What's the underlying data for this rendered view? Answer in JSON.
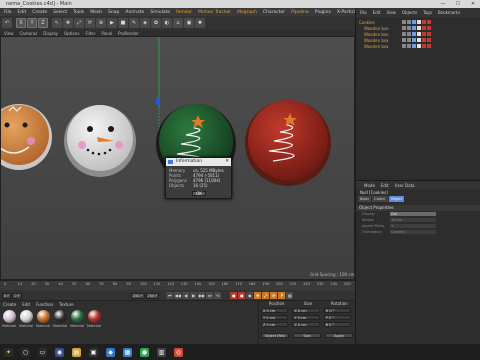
{
  "window": {
    "title": "nema_Cookies.c4d] - Main",
    "min": "—",
    "max": "☐",
    "close": "✕"
  },
  "menubar": [
    "File",
    "Edit",
    "Create",
    "Select",
    "Tools",
    "Mesh",
    "Snap",
    "Animate",
    "Simulate",
    "Render",
    "Motion Tracker",
    "Mograph",
    "Character",
    "Pipeline",
    "Plugins",
    "X-Particles",
    "RealFlow",
    "Octane",
    "Script",
    "Window",
    "Help"
  ],
  "menubar_highlight": [
    "Render",
    "Motion Tracker",
    "Mograph",
    "Pipeline",
    "Window",
    "Help"
  ],
  "toolbar": {
    "axis": [
      "X",
      "Y",
      "Z"
    ],
    "icons": [
      "undo-icon",
      "select-icon",
      "move-icon",
      "scale-icon",
      "rotate-icon",
      "coord-icon",
      "render-icon",
      "cube-icon",
      "pen-icon",
      "subdiv-icon",
      "flower-icon",
      "deform-icon",
      "scene-icon",
      "camera-icon",
      "light-icon"
    ]
  },
  "viewport": {
    "menu": [
      "View",
      "Cameras",
      "Display",
      "Options",
      "Filter",
      "Panel",
      "ProRender"
    ],
    "grid_label": "Grid Spacing : 100 cm"
  },
  "info_dialog": {
    "title": "Information",
    "close": "✕",
    "rows": [
      {
        "k": "Memory",
        "v": "ca. 525 MBytes"
      },
      {
        "k": "Points",
        "v": "4794 (-5011)"
      },
      {
        "k": "Polygons",
        "v": "4796 (11004)"
      },
      {
        "k": "Objects",
        "v": "16 (25)"
      }
    ],
    "ok": "OK"
  },
  "timeline": {
    "ticks": [
      "0",
      "10",
      "20",
      "30",
      "40",
      "50",
      "60",
      "70",
      "80",
      "90",
      "100",
      "110",
      "120",
      "130",
      "140",
      "150",
      "160",
      "170",
      "180",
      "190",
      "200",
      "210",
      "220",
      "230",
      "240",
      "250"
    ],
    "start": "0 F",
    "current": "0 F",
    "end": "250 F",
    "end2": "250 F",
    "buttons": [
      "⏮",
      "◀◀",
      "◀",
      "▶",
      "▶▶",
      "⏭",
      "⟲"
    ]
  },
  "materials": {
    "menu": [
      "Create",
      "Edit",
      "Function",
      "Texture"
    ],
    "items": [
      {
        "label": "Material",
        "color": "#d9c2d8"
      },
      {
        "label": "Material",
        "color": "#d6d6d6"
      },
      {
        "label": "Material",
        "color": "#c8702c"
      },
      {
        "label": "Material",
        "color": "#2e2e2e"
      },
      {
        "label": "Material",
        "color": "#2d6e3f"
      },
      {
        "label": "Material",
        "color": "#b0322c"
      }
    ]
  },
  "coords": {
    "headers": [
      "Position",
      "Size",
      "Rotation"
    ],
    "rows": [
      {
        "p": "X  0 cm",
        "s": "X  0 cm",
        "r": "H  0 °"
      },
      {
        "p": "Y  0 cm",
        "s": "Y  0 cm",
        "r": "P  0 °"
      },
      {
        "p": "Z  0 cm",
        "s": "Z  0 cm",
        "r": "B  0 °"
      }
    ],
    "mode": "Object (Rel)",
    "size_mode": "Size",
    "apply": "Apply"
  },
  "objects": {
    "menu": [
      "File",
      "Edit",
      "View",
      "Objects",
      "Tags",
      "Bookmarks"
    ],
    "rows": [
      {
        "name": "Cookies"
      },
      {
        "name": "Wooden box"
      },
      {
        "name": "Wooden box"
      },
      {
        "name": "Wooden box"
      },
      {
        "name": "Wooden box"
      }
    ]
  },
  "attributes": {
    "menu": [
      "Mode",
      "Edit",
      "User Data"
    ],
    "title": "Null [Cookies]",
    "tabs": [
      "Basic",
      "Coord.",
      "Object"
    ],
    "active_tab": "Object",
    "section": "Object Properties",
    "rows": [
      {
        "k": "Display",
        "v": "Dot",
        "sel": true
      },
      {
        "k": "Radius",
        "v": "10 cm",
        "sel": false
      },
      {
        "k": "Aspect Ratio",
        "v": "1",
        "sel": false
      },
      {
        "k": "Orientation",
        "v": "Camera",
        "sel": false
      }
    ]
  },
  "taskbar": {
    "icons": [
      {
        "name": "start-icon",
        "glyph": "✦",
        "color": "#2b2b2b"
      },
      {
        "name": "search-icon",
        "glyph": "○",
        "color": "#2b2b2b"
      },
      {
        "name": "taskview-icon",
        "glyph": "▭",
        "color": "#2b2b2b"
      },
      {
        "name": "cinema4d-icon",
        "glyph": "◉",
        "color": "#3a4c8a"
      },
      {
        "name": "explorer-icon",
        "glyph": "▤",
        "color": "#d8a42c"
      },
      {
        "name": "app-icon",
        "glyph": "▣",
        "color": "#333"
      },
      {
        "name": "vscode-icon",
        "glyph": "◆",
        "color": "#2a7bd1"
      },
      {
        "name": "store-icon",
        "glyph": "▦",
        "color": "#3a7fd0"
      },
      {
        "name": "whatsapp-icon",
        "glyph": "●",
        "color": "#2ea54f"
      },
      {
        "name": "files-icon",
        "glyph": "▥",
        "color": "#444"
      },
      {
        "name": "chrome-icon",
        "glyph": "◎",
        "color": "#d24b3a"
      }
    ]
  }
}
